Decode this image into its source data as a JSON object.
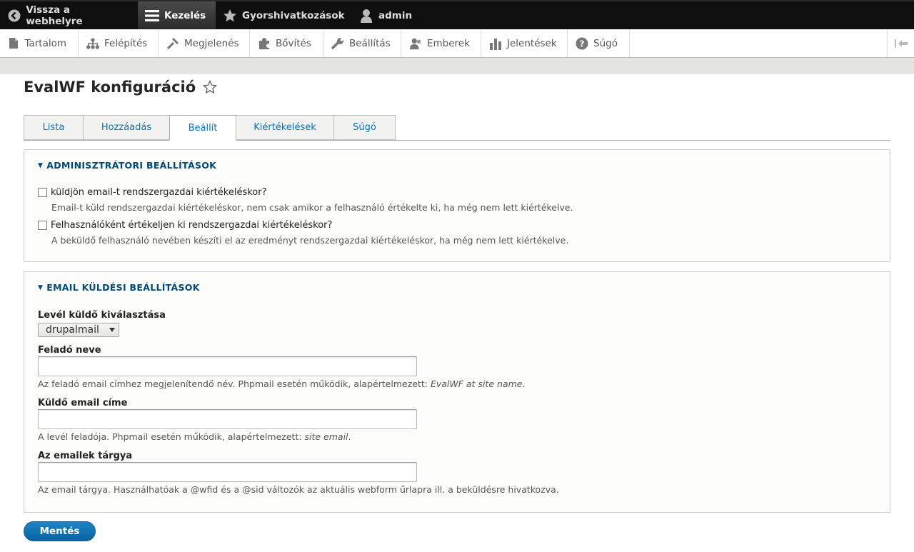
{
  "toolbar": {
    "back_label": "Vissza a webhelyre",
    "manage_label": "Kezelés",
    "shortcuts_label": "Gyorshivatkozások",
    "user_label": "admin"
  },
  "tray": {
    "items": [
      {
        "label": "Tartalom",
        "icon": "file-icon"
      },
      {
        "label": "Felépítés",
        "icon": "sitemap-icon"
      },
      {
        "label": "Megjelenés",
        "icon": "brush-icon"
      },
      {
        "label": "Bővítés",
        "icon": "puzzle-icon"
      },
      {
        "label": "Beállítás",
        "icon": "wrench-icon"
      },
      {
        "label": "Emberek",
        "icon": "people-icon"
      },
      {
        "label": "Jelentések",
        "icon": "bar-chart-icon"
      },
      {
        "label": "Súgó",
        "icon": "help-icon"
      }
    ]
  },
  "page": {
    "title": "EvalWF konfiguráció"
  },
  "tabs": [
    "Lista",
    "Hozzáadás",
    "Beállít",
    "Kiértékelések",
    "Súgó"
  ],
  "active_tab": "Beállít",
  "admin_settings": {
    "legend": "ADMINISZTRÁTORI BEÁLLÍTÁSOK",
    "cb1_label": "küldjön email-t rendszergazdai kiértékeléskor?",
    "cb1_desc": "Email-t küld rendszergazdai kiértékeléskor, nem csak amikor a felhasználó értékelte ki, ha még nem lett kiértékelve.",
    "cb2_label": "Felhasználóként értékeljen ki rendszergazdai kiértékeléskor?",
    "cb2_desc": "A beküldő felhasználó nevében készíti el az eredményt rendszergazdai kiértékeléskor, ha még nem lett kiértékelve."
  },
  "email_settings": {
    "legend": "EMAIL KÜLDÉSI BEÁLLÍTÁSOK",
    "mailer_label": "Levél küldő kiválasztása",
    "mailer_value": "drupalmail",
    "sender_name_label": "Feladó neve",
    "sender_name_value": "",
    "sender_name_desc": "Az feladó email címhez megjelenítendő név. Phpmail esetén működik, alapértelmezett: ",
    "sender_name_default": "EvalWF at site name",
    "sender_email_label": "Küldő email címe",
    "sender_email_value": "",
    "sender_email_desc": "A levél feladója. Phpmail esetén működik, alapértelmezett: ",
    "sender_email_default": "site email",
    "subject_label": "Az emailek tárgya",
    "subject_value": "",
    "subject_desc": "Az email tárgya. Használhatóak a @wfid és a @sid változók az aktuális webform űrlapra ill. a beküldésre hivatkozva."
  },
  "save_label": "Mentés"
}
